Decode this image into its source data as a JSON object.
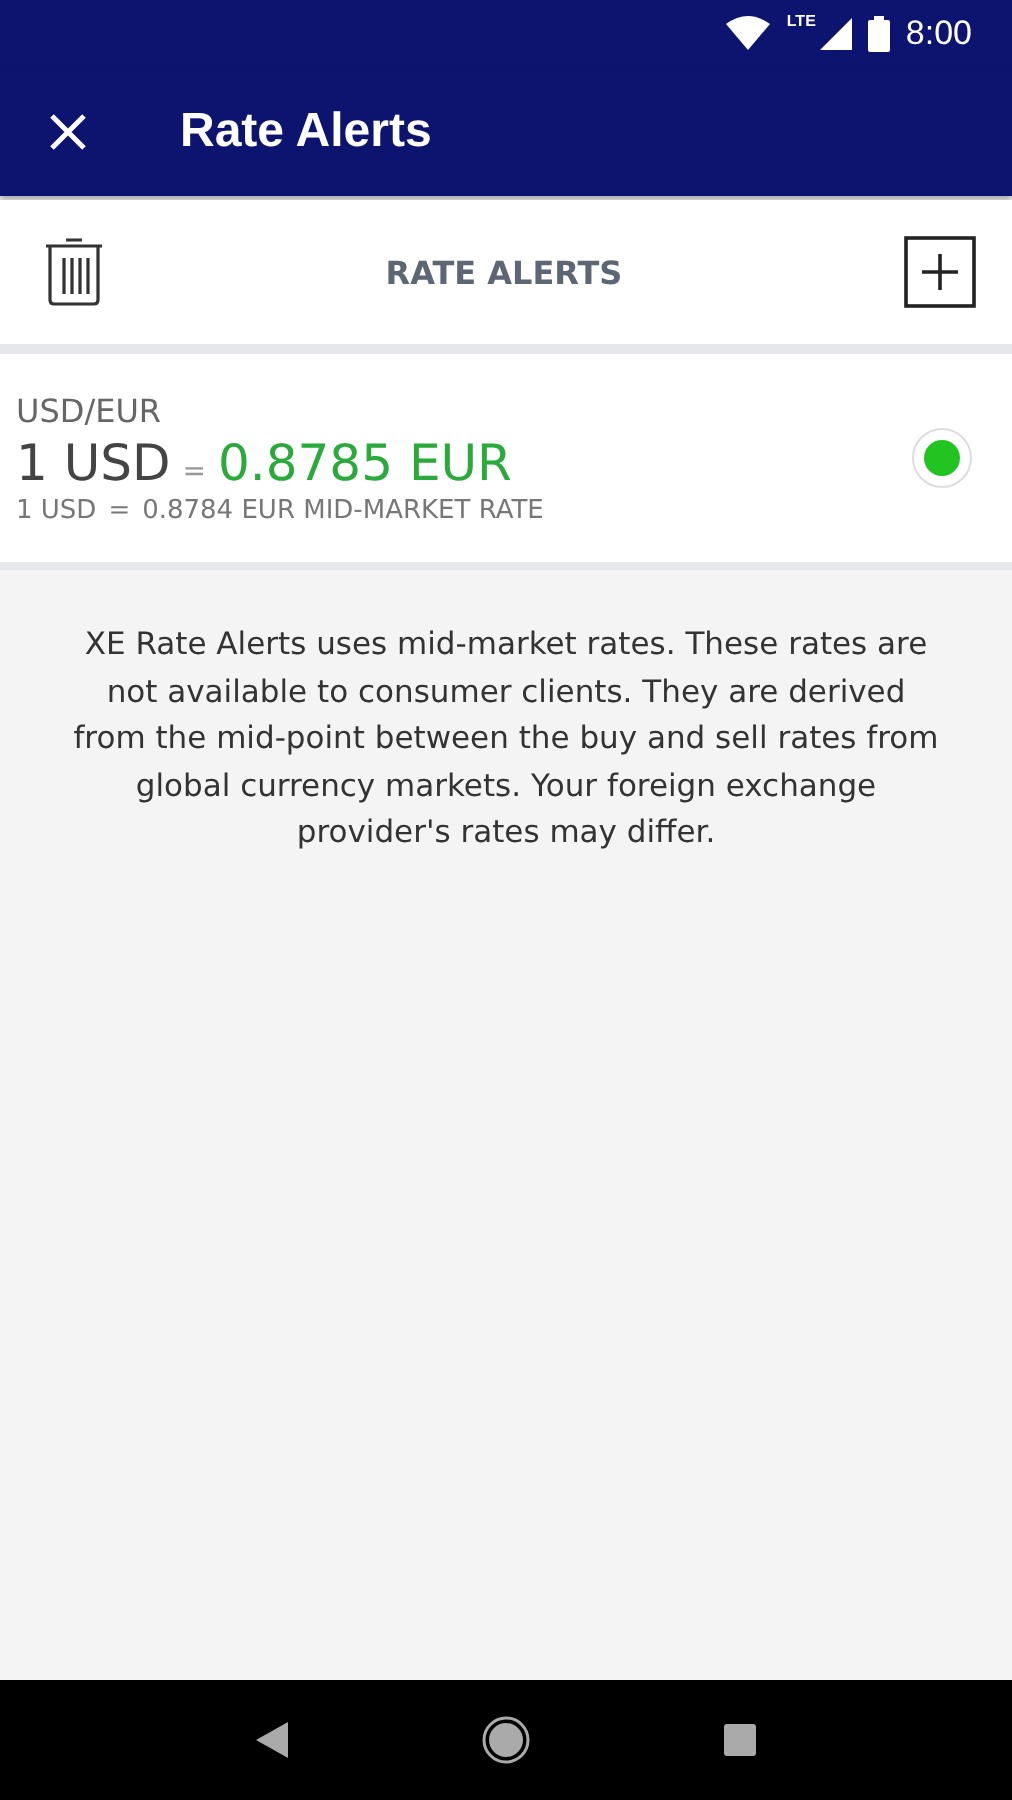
{
  "status_bar": {
    "network": "LTE",
    "time": "8:00"
  },
  "app_bar": {
    "title": "Rate Alerts"
  },
  "toolbar": {
    "title": "RATE ALERTS"
  },
  "alerts": [
    {
      "pair": "USD/EUR",
      "base": "1 USD",
      "equals": "=",
      "target": "0.8785 EUR",
      "mid_base": "1 USD",
      "mid_equals": "=",
      "mid_rate": "0.8784 EUR MID-MARKET RATE",
      "active": true
    }
  ],
  "disclaimer": "XE Rate Alerts uses mid-market rates. These rates are not available to consumer clients. They are derived from the mid-point between the buy and sell rates from global currency markets. Your foreign exchange provider's rates may differ."
}
